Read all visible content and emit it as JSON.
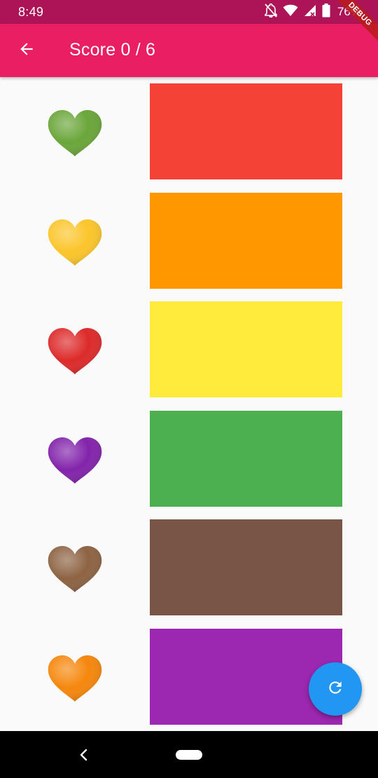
{
  "status_bar": {
    "time": "8:49",
    "battery": "76%",
    "icons": [
      "notifications-off-icon",
      "wifi-icon",
      "signal-icon",
      "battery-icon"
    ]
  },
  "app_bar": {
    "back_icon": "arrow-back-icon",
    "title": "Score 0 / 6",
    "debug_banner": "DEBUG"
  },
  "colors": {
    "status_bar_bg": "#ad1457",
    "app_bar_bg": "#e91e63",
    "fab_bg": "#2196f3",
    "page_bg": "#fafafa"
  },
  "rows": [
    {
      "heart_icon": "green-heart-icon",
      "heart_color": "#6aa63a",
      "swatch_color": "#f44336"
    },
    {
      "heart_icon": "yellow-heart-icon",
      "heart_color": "#fbc52b",
      "swatch_color": "#ff9800"
    },
    {
      "heart_icon": "red-heart-icon",
      "heart_color": "#dd2a2a",
      "swatch_color": "#ffeb3b"
    },
    {
      "heart_icon": "purple-heart-icon",
      "heart_color": "#8224ab",
      "swatch_color": "#4caf50"
    },
    {
      "heart_icon": "brown-heart-icon",
      "heart_color": "#8d6343",
      "swatch_color": "#795548"
    },
    {
      "heart_icon": "orange-heart-icon",
      "heart_color": "#f5870d",
      "swatch_color": "#9c27b0"
    }
  ],
  "fab": {
    "icon": "refresh-icon"
  },
  "nav_bar": {
    "icons": [
      "nav-back-icon",
      "nav-home-pill"
    ]
  }
}
